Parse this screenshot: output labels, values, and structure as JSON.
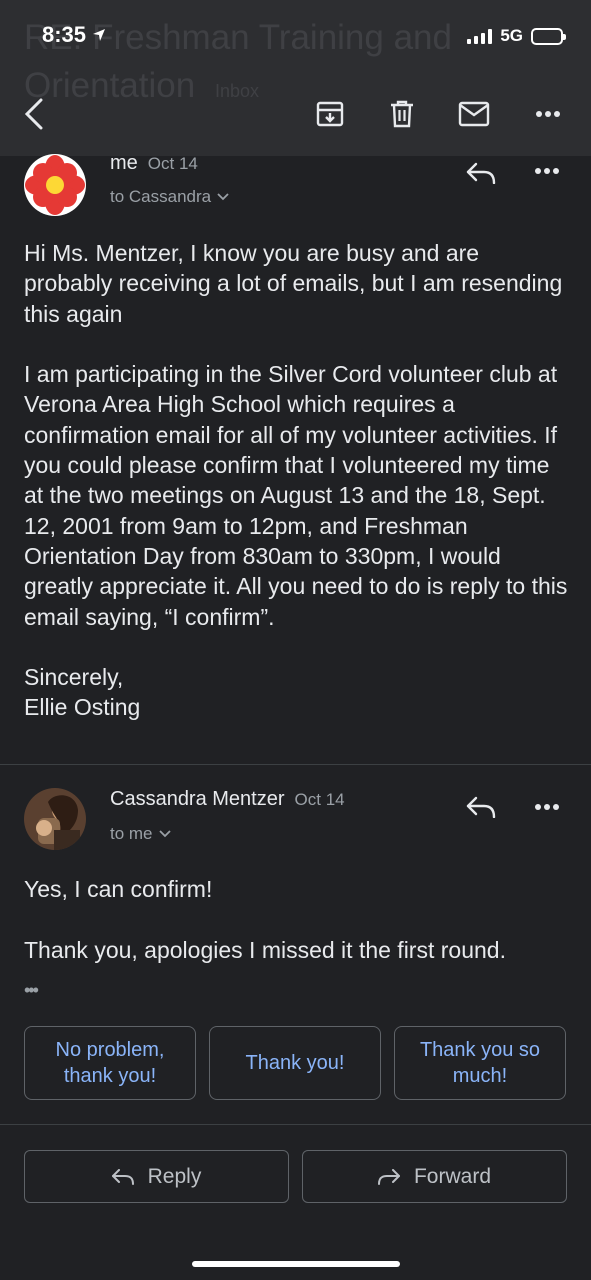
{
  "status": {
    "time": "8:35",
    "network": "5G"
  },
  "thread": {
    "subject": "RE: Freshman Training and Orientation",
    "label": "Inbox"
  },
  "toolbar": {
    "back_icon": "back-arrow-icon",
    "archive_icon": "archive-icon",
    "delete_icon": "trash-icon",
    "unread_icon": "mail-icon",
    "more_icon": "more-horizontal-icon"
  },
  "messages": [
    {
      "sender": "me",
      "date": "Oct 14",
      "recipient": "to Cassandra",
      "body": [
        "Hi Ms. Mentzer, I know you are busy and are probably receiving a lot of emails, but I am resending this again",
        "I am participating in the Silver Cord volunteer club at Verona Area High School which requires a confirmation email for all of my volunteer activities. If you could please confirm that I volunteered my time at the two meetings on August 13 and the 18, Sept. 12, 2001 from 9am to 12pm, and Freshman Orientation Day from 830am to 330pm, I would greatly appreciate it. All you need to do is reply to this email saying, “I confirm”.",
        "Sincerely,\nEllie Osting"
      ]
    },
    {
      "sender": "Cassandra Mentzer",
      "date": "Oct 14",
      "recipient": "to me",
      "body": [
        "Yes, I can confirm!",
        "Thank you, apologies I missed it the first round."
      ],
      "trimmed": "•••"
    }
  ],
  "smart_replies": [
    "No problem, thank you!",
    "Thank you!",
    "Thank you so much!"
  ],
  "actions": {
    "reply": "Reply",
    "forward": "Forward"
  },
  "colors": {
    "background": "#202124",
    "toolbar": "#2d2e31",
    "accent": "#8ab4f8",
    "text": "#e8eaed",
    "secondary": "#9aa0a6"
  }
}
